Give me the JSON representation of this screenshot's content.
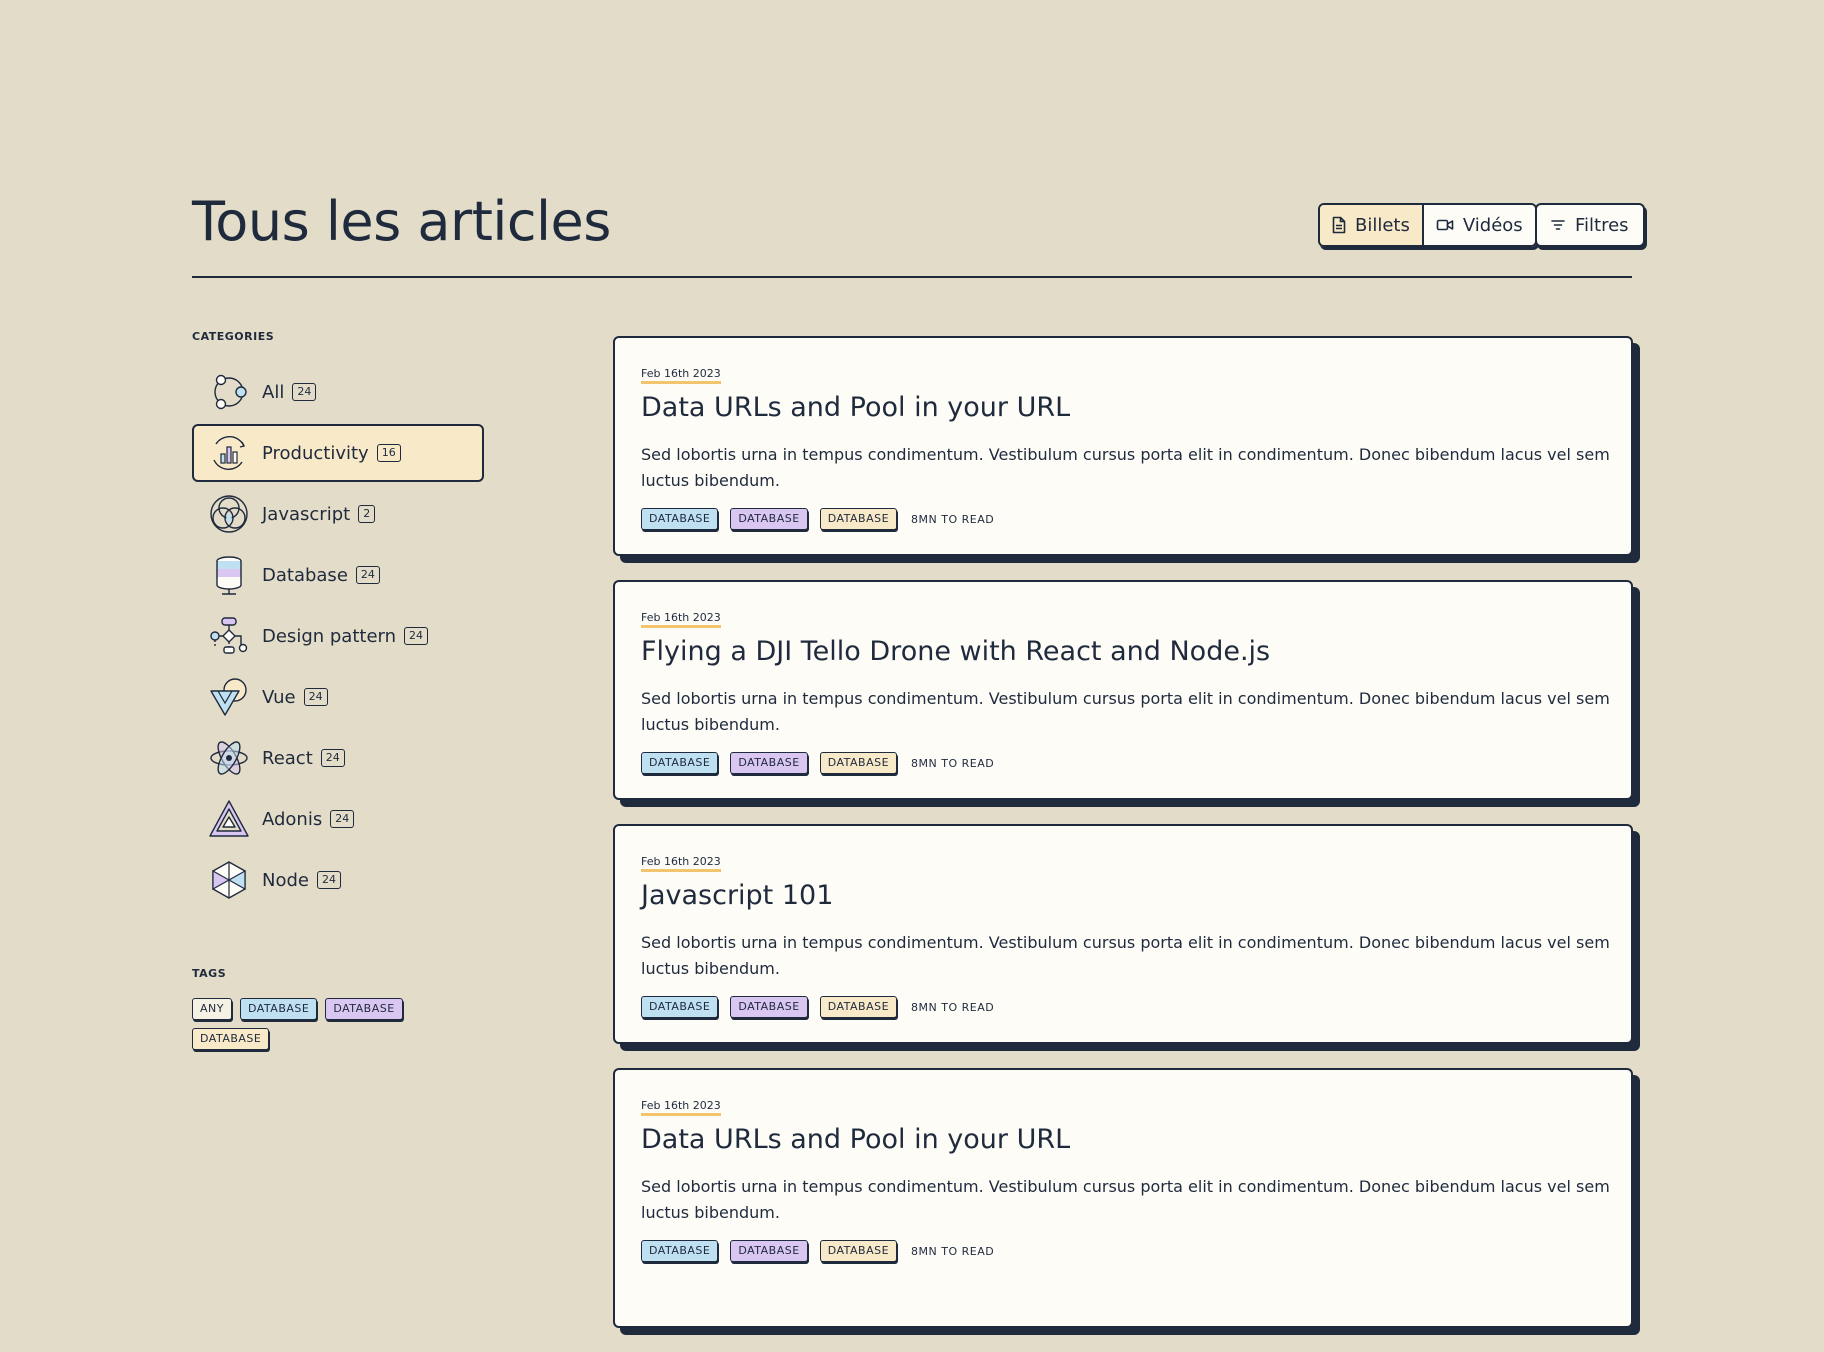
{
  "header": {
    "title": "Tous les articles",
    "view_toggle": {
      "posts_label": "Billets",
      "videos_label": "Vidéos",
      "active": "posts"
    },
    "filters_label": "Filtres"
  },
  "sidebar": {
    "categories_heading": "CATEGORIES",
    "categories": [
      {
        "label": "All",
        "count": "24",
        "icon": "all-network-icon"
      },
      {
        "label": "Productivity",
        "count": "16",
        "icon": "productivity-chart-icon",
        "active": true
      },
      {
        "label": "Javascript",
        "count": "2",
        "icon": "javascript-venn-icon"
      },
      {
        "label": "Database",
        "count": "24",
        "icon": "database-icon"
      },
      {
        "label": "Design pattern",
        "count": "24",
        "icon": "design-pattern-flowchart-icon"
      },
      {
        "label": "Vue",
        "count": "24",
        "icon": "vue-triangle-icon"
      },
      {
        "label": "React",
        "count": "24",
        "icon": "react-atom-icon"
      },
      {
        "label": "Adonis",
        "count": "24",
        "icon": "adonis-triangle-icon"
      },
      {
        "label": "Node",
        "count": "24",
        "icon": "node-hexagon-icon"
      }
    ],
    "tags_heading": "TAGS",
    "tags": [
      {
        "label": "ANY",
        "color": "plain"
      },
      {
        "label": "DATABASE",
        "color": "blue"
      },
      {
        "label": "DATABASE",
        "color": "purple"
      },
      {
        "label": "DATABASE",
        "color": "cream"
      }
    ]
  },
  "articles": [
    {
      "date": "Feb 16th 2023",
      "title": "Data URLs and Pool in your URL",
      "excerpt": "Sed lobortis urna in tempus condimentum. Vestibulum cursus porta elit in condimentum. Donec bibendum lacus vel sem luctus bibendum.",
      "tags": [
        "DATABASE",
        "DATABASE",
        "DATABASE"
      ],
      "read_time": "8MN TO READ"
    },
    {
      "date": "Feb 16th 2023",
      "title": "Flying a DJI Tello Drone with React and Node.js",
      "excerpt": "Sed lobortis urna in tempus condimentum. Vestibulum cursus porta elit in condimentum. Donec bibendum lacus vel sem luctus bibendum.",
      "tags": [
        "DATABASE",
        "DATABASE",
        "DATABASE"
      ],
      "read_time": "8MN TO READ"
    },
    {
      "date": "Feb 16th 2023",
      "title": "Javascript 101",
      "excerpt": "Sed lobortis urna in tempus condimentum. Vestibulum cursus porta elit in condimentum. Donec bibendum lacus vel sem luctus bibendum.",
      "tags": [
        "DATABASE",
        "DATABASE",
        "DATABASE"
      ],
      "read_time": "8MN TO READ"
    },
    {
      "date": "Feb 16th 2023",
      "title": "Data URLs and Pool in your URL",
      "excerpt": "Sed lobortis urna in tempus condimentum. Vestibulum cursus porta elit in condimentum. Donec bibendum lacus vel sem luctus bibendum.",
      "tags": [
        "DATABASE",
        "DATABASE",
        "DATABASE"
      ],
      "read_time": "8MN TO READ"
    }
  ],
  "colors": {
    "background": "#e3dcc8",
    "ink": "#1f2a3d",
    "card": "#fdfcf7",
    "highlight": "#f8e9c8",
    "tag_blue": "#bfe0f1",
    "tag_purple": "#d9c6f1",
    "date_underline": "#f2c46b"
  }
}
